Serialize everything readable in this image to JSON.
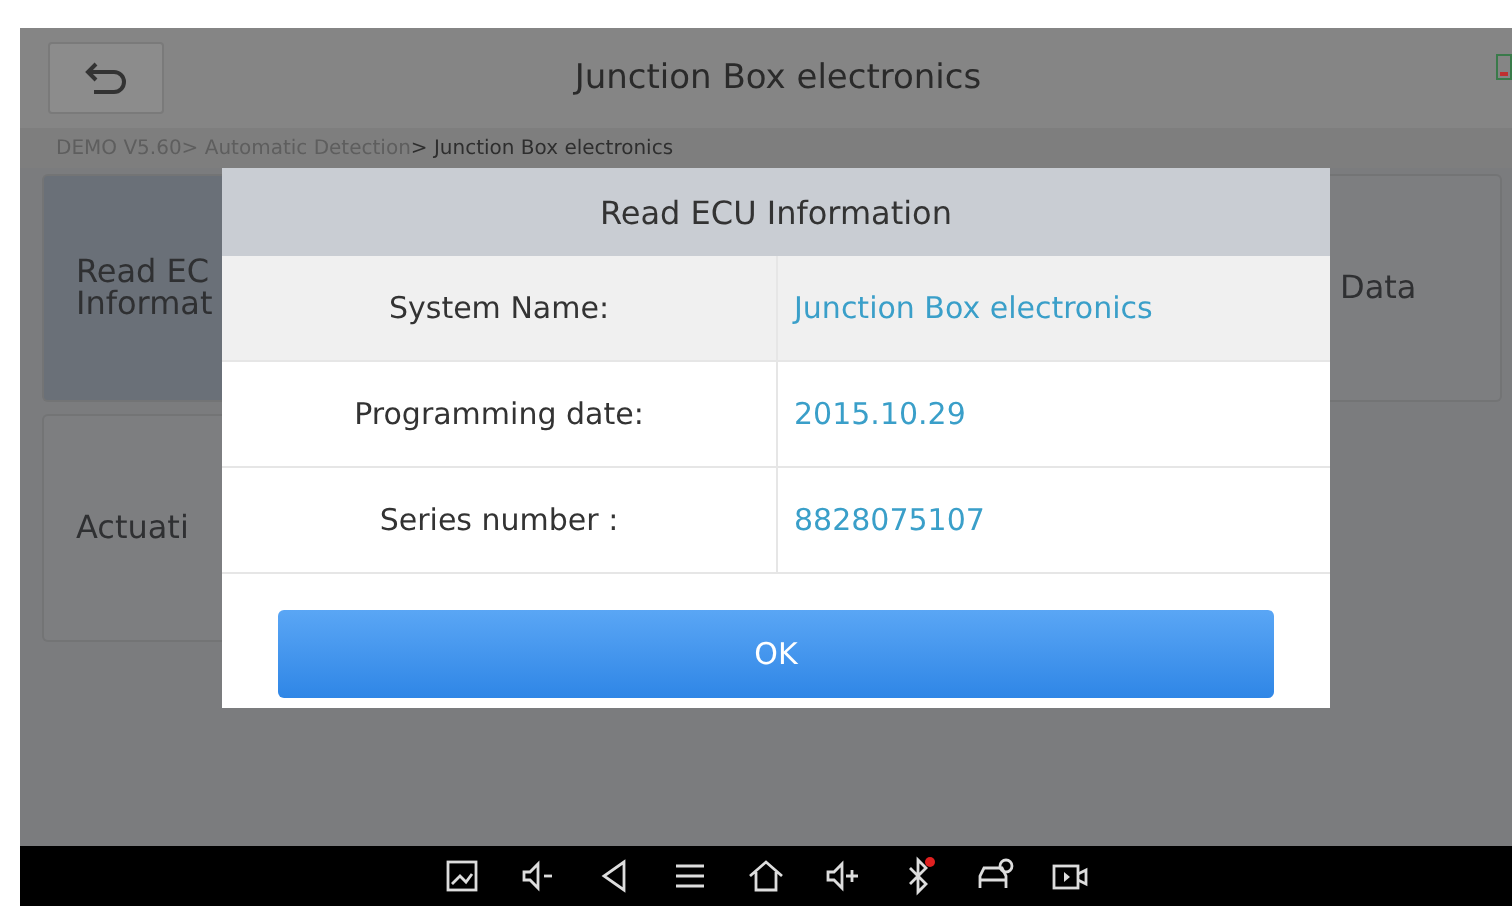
{
  "header": {
    "title": "Junction Box electronics"
  },
  "breadcrumb": {
    "path": "DEMO V5.60> Automatic Detection",
    "current": "> Junction Box electronics"
  },
  "left_tiles": [
    {
      "lines": [
        "Read EC",
        "Informat"
      ],
      "selected": true
    },
    {
      "lines": [
        "Actuati"
      ],
      "selected": false
    }
  ],
  "right_tiles": [
    {
      "lines": [
        "Data"
      ],
      "selected": false
    }
  ],
  "dialog": {
    "title": "Read ECU Information",
    "rows": [
      {
        "label": "System Name:",
        "value": "Junction Box electronics"
      },
      {
        "label": "Programming date:",
        "value": "2015.10.29"
      },
      {
        "label": "Series number :",
        "value": "8828075107"
      }
    ],
    "button": "OK"
  },
  "navbar": {
    "bluetooth_alert": true
  }
}
